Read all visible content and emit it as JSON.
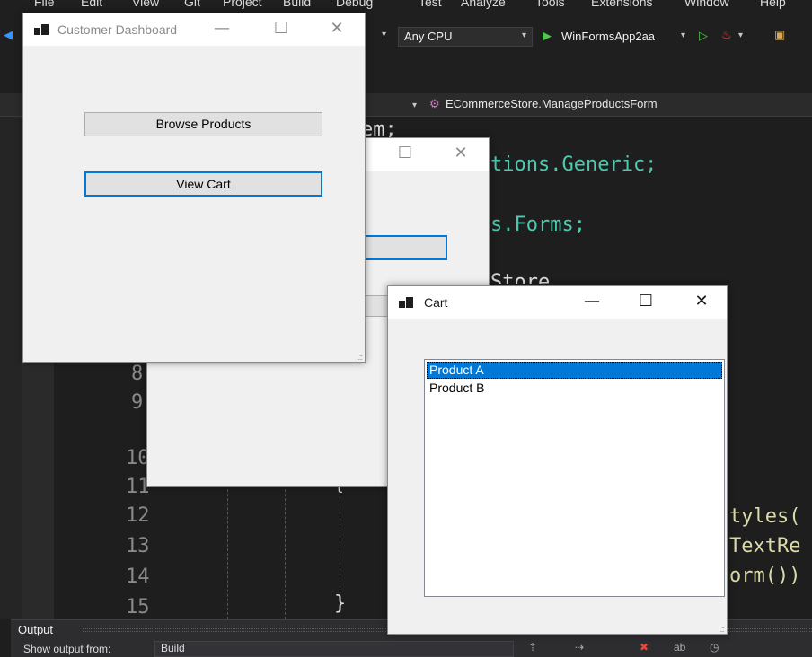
{
  "ide": {
    "menu": [
      "File",
      "Edit",
      "View",
      "Git",
      "Project",
      "Build",
      "Debug",
      "Test",
      "Analyze",
      "Tools",
      "Extensions",
      "Window",
      "Help"
    ],
    "toolbar": {
      "platform": "Any CPU",
      "run_target": "WinFormsApp2aa"
    },
    "navbar": {
      "class_path": "ECommerceStore.ManageProductsForm"
    },
    "code_lines": [
      {
        "text": "em;"
      },
      {
        "text": "tions.Generic;"
      },
      {
        "text": "s.Forms;"
      },
      {
        "text": "Store"
      },
      {
        "text": "tyles("
      },
      {
        "text": "TextRe"
      },
      {
        "text": "orm())"
      }
    ],
    "line_numbers": [
      "8",
      "9",
      "10",
      "11",
      "12",
      "13",
      "14",
      "15"
    ],
    "brace_open": "{",
    "brace_close": "}",
    "output": {
      "title": "Output",
      "show_from_label": "Show output from:",
      "show_from_value": "Build"
    }
  },
  "windows": {
    "customer_dashboard": {
      "title": "Customer Dashboard",
      "browse_button": "Browse Products",
      "view_cart_button": "View Cart"
    },
    "cart": {
      "title": "Cart",
      "items": [
        "Product A",
        "Product B"
      ],
      "selected_index": 0
    }
  },
  "icons": {
    "minimize": "minimize-icon",
    "maximize": "maximize-icon",
    "close": "close-icon"
  },
  "colors": {
    "selection": "#0078d7",
    "ide_bg": "#1e1e1e",
    "form_bg": "#f0f0f0"
  }
}
